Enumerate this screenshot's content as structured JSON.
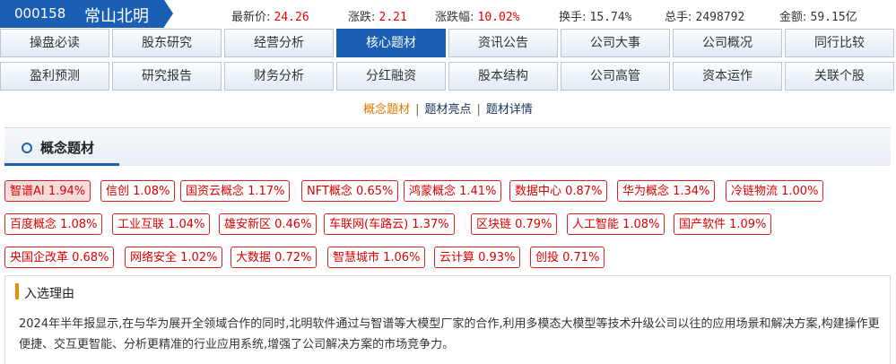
{
  "stock": {
    "code": "000158",
    "name": "常山北明"
  },
  "stats": [
    {
      "label": "最新价:",
      "value": "24.26"
    },
    {
      "label": "涨跌:",
      "value": "2.21"
    },
    {
      "label": "涨跌幅:",
      "value": "10.02%"
    },
    {
      "label": "换手:",
      "value": "15.74%"
    },
    {
      "label": "总手:",
      "value": "2498792"
    },
    {
      "label": "金额:",
      "value": "59.15亿"
    }
  ],
  "nav_row1": [
    "操盘必读",
    "股东研究",
    "经营分析",
    "核心题材",
    "资讯公告",
    "公司大事",
    "公司概况",
    "同行比较"
  ],
  "nav_row2": [
    "盈利预测",
    "研究报告",
    "财务分析",
    "分红融资",
    "股本结构",
    "公司高管",
    "资本运作",
    "关联个股"
  ],
  "subnav": [
    "概念题材",
    "题材亮点",
    "题材详情"
  ],
  "panel_title": "概念题材",
  "tags": [
    [
      "智谱AI 1.94%",
      "信创 1.08%",
      "国资云概念 1.17%",
      "NFT概念 0.65%",
      "鸿蒙概念 1.41%",
      "数据中心 0.87%",
      "华为概念 1.34%",
      "冷链物流 1.00%"
    ],
    [
      "百度概念 1.08%",
      "工业互联 1.04%",
      "雄安新区 0.46%",
      "车联网(车路云) 1.37%",
      "区块链 0.79%",
      "人工智能 1.08%",
      "国产软件 1.09%"
    ],
    [
      "央国企改革 0.68%",
      "网络安全 1.02%",
      "大数据 0.72%",
      "智慧城市 1.06%",
      "云计算 0.93%",
      "创投 0.71%"
    ]
  ],
  "reason": {
    "title": "入选理由",
    "text": "2024年半年报显示,在与华为展开全领域合作的同时,北明软件通过与智谱等大模型厂家的合作,利用多模态大模型等技术升级公司以往的应用场景和解决方案,构建操作更便捷、交互更智能、分析更精准的行业应用系统,增强了公司解决方案的市场竞争力。"
  },
  "colors": {
    "accent": "#1a5fb4",
    "up": "#e00000",
    "highlight": "#ee8c00"
  }
}
